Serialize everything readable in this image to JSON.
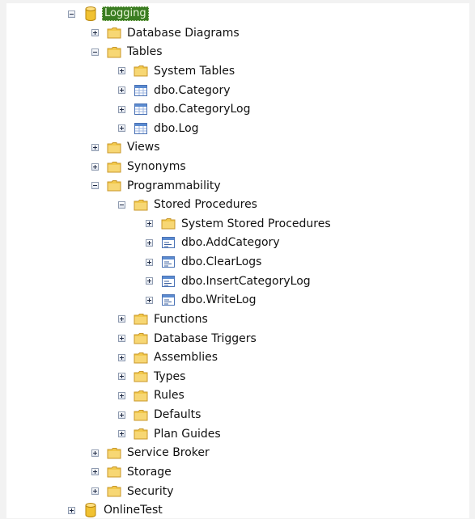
{
  "tree": {
    "nodes": [
      {
        "label": "Logging",
        "icon": "database-icon",
        "expanded": true,
        "selected": true
      },
      {
        "label": "Database Diagrams",
        "icon": "folder-icon",
        "expanded": false
      },
      {
        "label": "Tables",
        "icon": "folder-icon",
        "expanded": true
      },
      {
        "label": "System Tables",
        "icon": "folder-icon",
        "expanded": false
      },
      {
        "label": "dbo.Category",
        "icon": "table-icon",
        "expanded": false
      },
      {
        "label": "dbo.CategoryLog",
        "icon": "table-icon",
        "expanded": false
      },
      {
        "label": "dbo.Log",
        "icon": "table-icon",
        "expanded": false
      },
      {
        "label": "Views",
        "icon": "folder-icon",
        "expanded": false
      },
      {
        "label": "Synonyms",
        "icon": "folder-icon",
        "expanded": false
      },
      {
        "label": "Programmability",
        "icon": "folder-icon",
        "expanded": true
      },
      {
        "label": "Stored Procedures",
        "icon": "folder-icon",
        "expanded": true
      },
      {
        "label": "System Stored Procedures",
        "icon": "folder-icon",
        "expanded": false
      },
      {
        "label": "dbo.AddCategory",
        "icon": "stored-procedure-icon",
        "expanded": false
      },
      {
        "label": "dbo.ClearLogs",
        "icon": "stored-procedure-icon",
        "expanded": false
      },
      {
        "label": "dbo.InsertCategoryLog",
        "icon": "stored-procedure-icon",
        "expanded": false
      },
      {
        "label": "dbo.WriteLog",
        "icon": "stored-procedure-icon",
        "expanded": false
      },
      {
        "label": "Functions",
        "icon": "folder-icon",
        "expanded": false
      },
      {
        "label": "Database Triggers",
        "icon": "folder-icon",
        "expanded": false
      },
      {
        "label": "Assemblies",
        "icon": "folder-icon",
        "expanded": false
      },
      {
        "label": "Types",
        "icon": "folder-icon",
        "expanded": false
      },
      {
        "label": "Rules",
        "icon": "folder-icon",
        "expanded": false
      },
      {
        "label": "Defaults",
        "icon": "folder-icon",
        "expanded": false
      },
      {
        "label": "Plan Guides",
        "icon": "folder-icon",
        "expanded": false
      },
      {
        "label": "Service Broker",
        "icon": "folder-icon",
        "expanded": false
      },
      {
        "label": "Storage",
        "icon": "folder-icon",
        "expanded": false
      },
      {
        "label": "Security",
        "icon": "folder-icon",
        "expanded": false
      },
      {
        "label": "OnlineTest",
        "icon": "database-icon",
        "expanded": false
      }
    ]
  }
}
